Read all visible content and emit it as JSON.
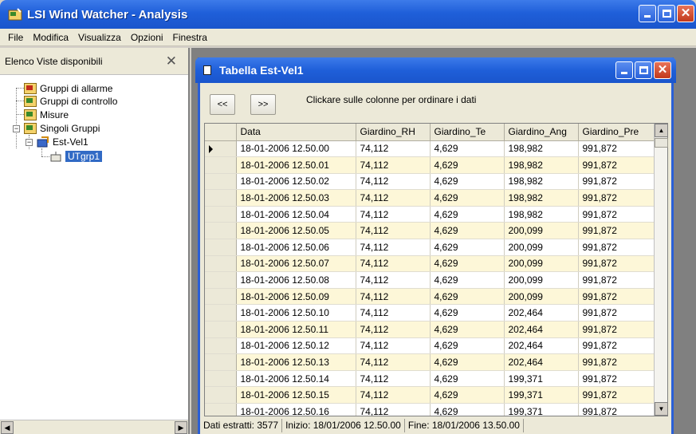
{
  "app": {
    "title": "LSI Wind Watcher - Analysis"
  },
  "menu": [
    {
      "label": "File"
    },
    {
      "label": "Modifica"
    },
    {
      "label": "Visualizza"
    },
    {
      "label": "Opzioni"
    },
    {
      "label": "Finestra"
    }
  ],
  "left_panel": {
    "header": "Elenco Viste disponibili",
    "close_glyph": "✕",
    "tree": {
      "gruppi_allarme": "Gruppi di allarme",
      "gruppi_controllo": "Gruppi di controllo",
      "misure": "Misure",
      "singoli_gruppi": "Singoli Gruppi",
      "est_vel1": "Est-Vel1",
      "utgrp1": "UTgrp1"
    }
  },
  "child_window": {
    "title": "Tabella Est-Vel1",
    "prev_label": "<<",
    "next_label": ">>",
    "hint": "Clickare sulle colonne per ordinare i dati"
  },
  "table": {
    "columns": [
      "Data",
      "Giardino_RH",
      "Giardino_Te",
      "Giardino_Ang",
      "Giardino_Pre"
    ],
    "rows": [
      [
        "18-01-2006 12.50.00",
        "74,112",
        "4,629",
        "198,982",
        "991,872"
      ],
      [
        "18-01-2006 12.50.01",
        "74,112",
        "4,629",
        "198,982",
        "991,872"
      ],
      [
        "18-01-2006 12.50.02",
        "74,112",
        "4,629",
        "198,982",
        "991,872"
      ],
      [
        "18-01-2006 12.50.03",
        "74,112",
        "4,629",
        "198,982",
        "991,872"
      ],
      [
        "18-01-2006 12.50.04",
        "74,112",
        "4,629",
        "198,982",
        "991,872"
      ],
      [
        "18-01-2006 12.50.05",
        "74,112",
        "4,629",
        "200,099",
        "991,872"
      ],
      [
        "18-01-2006 12.50.06",
        "74,112",
        "4,629",
        "200,099",
        "991,872"
      ],
      [
        "18-01-2006 12.50.07",
        "74,112",
        "4,629",
        "200,099",
        "991,872"
      ],
      [
        "18-01-2006 12.50.08",
        "74,112",
        "4,629",
        "200,099",
        "991,872"
      ],
      [
        "18-01-2006 12.50.09",
        "74,112",
        "4,629",
        "200,099",
        "991,872"
      ],
      [
        "18-01-2006 12.50.10",
        "74,112",
        "4,629",
        "202,464",
        "991,872"
      ],
      [
        "18-01-2006 12.50.11",
        "74,112",
        "4,629",
        "202,464",
        "991,872"
      ],
      [
        "18-01-2006 12.50.12",
        "74,112",
        "4,629",
        "202,464",
        "991,872"
      ],
      [
        "18-01-2006 12.50.13",
        "74,112",
        "4,629",
        "202,464",
        "991,872"
      ],
      [
        "18-01-2006 12.50.14",
        "74,112",
        "4,629",
        "199,371",
        "991,872"
      ],
      [
        "18-01-2006 12.50.15",
        "74,112",
        "4,629",
        "199,371",
        "991,872"
      ],
      [
        "18-01-2006 12.50.16",
        "74,112",
        "4,629",
        "199,371",
        "991,872"
      ]
    ]
  },
  "status": {
    "dati": "Dati estratti: 3577",
    "inizio": "Inizio: 18/01/2006 12.50.00",
    "fine": "Fine: 18/01/2006 13.50.00"
  },
  "colors": {
    "titlebar_blue": "#1f5fd9",
    "close_red": "#c2391b",
    "row_alt": "#fdf7d8",
    "selection": "#316ac5"
  }
}
